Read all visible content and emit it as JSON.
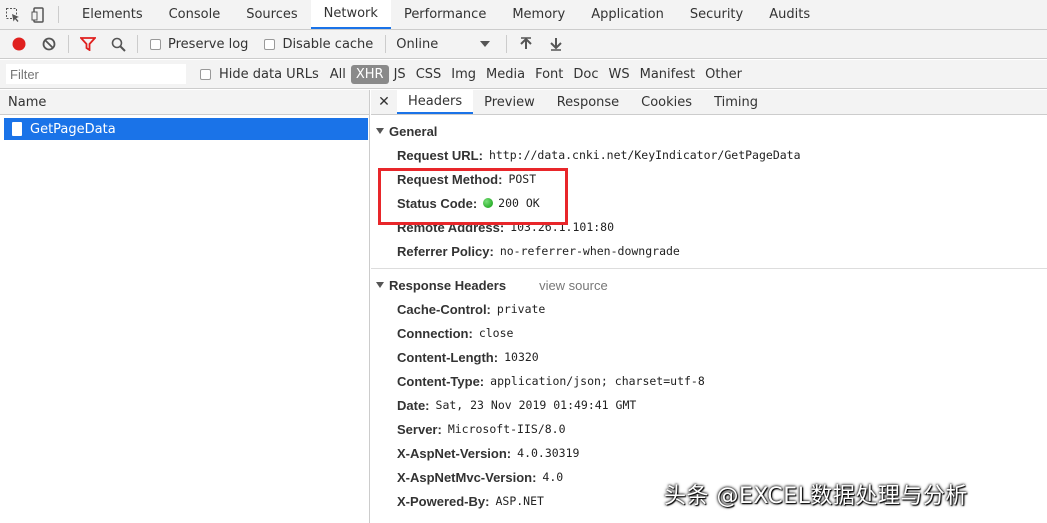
{
  "main_tabs": [
    "Elements",
    "Console",
    "Sources",
    "Network",
    "Performance",
    "Memory",
    "Application",
    "Security",
    "Audits"
  ],
  "active_main_tab": "Network",
  "toolbar": {
    "preserve_log": "Preserve log",
    "disable_cache": "Disable cache",
    "throttle": "Online"
  },
  "filterbar": {
    "placeholder": "Filter",
    "hide_data_urls": "Hide data URLs",
    "types": [
      "All",
      "XHR",
      "JS",
      "CSS",
      "Img",
      "Media",
      "Font",
      "Doc",
      "WS",
      "Manifest",
      "Other"
    ],
    "active_type": "XHR"
  },
  "list": {
    "header": "Name",
    "selected_item": "GetPageData"
  },
  "detail_tabs": [
    "Headers",
    "Preview",
    "Response",
    "Cookies",
    "Timing"
  ],
  "general": {
    "title": "General",
    "rows": [
      {
        "k": "Request URL:",
        "v": "http://data.cnki.net/KeyIndicator/GetPageData"
      },
      {
        "k": "Request Method:",
        "v": "POST"
      },
      {
        "k": "Status Code:",
        "v": "200 OK"
      },
      {
        "k": "Remote Address:",
        "v": "103.26.1.101:80"
      },
      {
        "k": "Referrer Policy:",
        "v": "no-referrer-when-downgrade"
      }
    ]
  },
  "response_headers": {
    "title": "Response Headers",
    "view_source": "view source",
    "rows": [
      {
        "k": "Cache-Control:",
        "v": "private"
      },
      {
        "k": "Connection:",
        "v": "close"
      },
      {
        "k": "Content-Length:",
        "v": "10320"
      },
      {
        "k": "Content-Type:",
        "v": "application/json; charset=utf-8"
      },
      {
        "k": "Date:",
        "v": "Sat, 23 Nov 2019 01:49:41 GMT"
      },
      {
        "k": "Server:",
        "v": "Microsoft-IIS/8.0"
      },
      {
        "k": "X-AspNet-Version:",
        "v": "4.0.30319"
      },
      {
        "k": "X-AspNetMvc-Version:",
        "v": "4.0"
      },
      {
        "k": "X-Powered-By:",
        "v": "ASP.NET"
      }
    ]
  },
  "watermark": "头条 @EXCEL数据处理与分析",
  "colors": {
    "accent": "#1a73e8",
    "highlight": "#e8262a",
    "record": "#e0201e"
  }
}
